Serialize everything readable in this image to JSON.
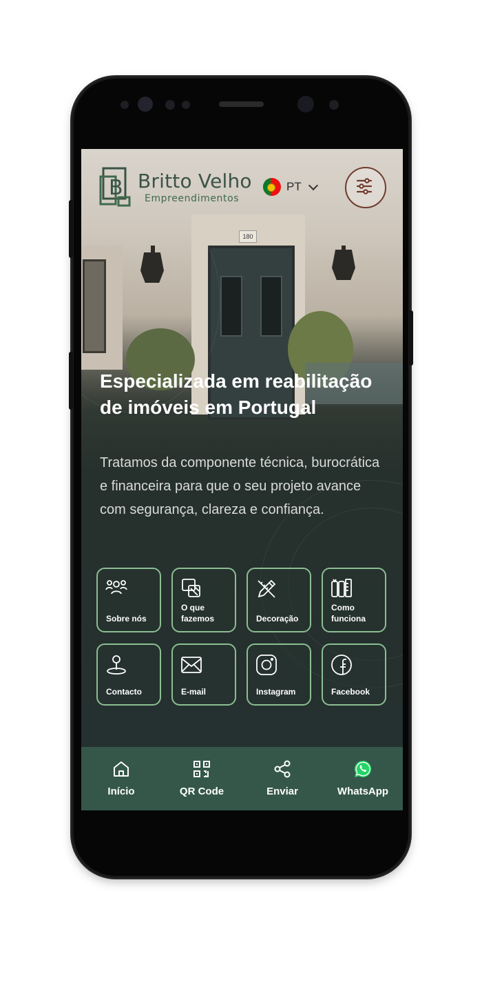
{
  "header": {
    "brand_name": "Britto Velho",
    "brand_sub": "Empreendimentos",
    "language": "PT",
    "logo_letter": "B"
  },
  "hero": {
    "title": "Especializada em reabilitação de imóveis em Portugal",
    "subtitle": "Tratamos da componente técnica, burocrática e financeira para que o seu projeto avance com segurança, clareza e confiança.",
    "house_number": "180"
  },
  "tiles": [
    {
      "label": "Sobre nós",
      "icon": "people-icon"
    },
    {
      "label": "O que fazemos",
      "icon": "services-icon"
    },
    {
      "label": "Decoração",
      "icon": "pencil-ruler-icon"
    },
    {
      "label": "Como funciona",
      "icon": "process-icon"
    },
    {
      "label": "Contacto",
      "icon": "location-pin-icon"
    },
    {
      "label": "E-mail",
      "icon": "mail-icon"
    },
    {
      "label": "Instagram",
      "icon": "instagram-icon"
    },
    {
      "label": "Facebook",
      "icon": "facebook-icon"
    }
  ],
  "bottom_nav": [
    {
      "label": "Início",
      "icon": "home-icon"
    },
    {
      "label": "QR Code",
      "icon": "qr-code-icon"
    },
    {
      "label": "Enviar",
      "icon": "share-icon"
    },
    {
      "label": "WhatsApp",
      "icon": "whatsapp-icon"
    }
  ],
  "colors": {
    "accent_green": "#8bbf93",
    "nav_bg": "#34574a",
    "whatsapp": "#25d366",
    "menu_border": "#6e3b2c"
  }
}
